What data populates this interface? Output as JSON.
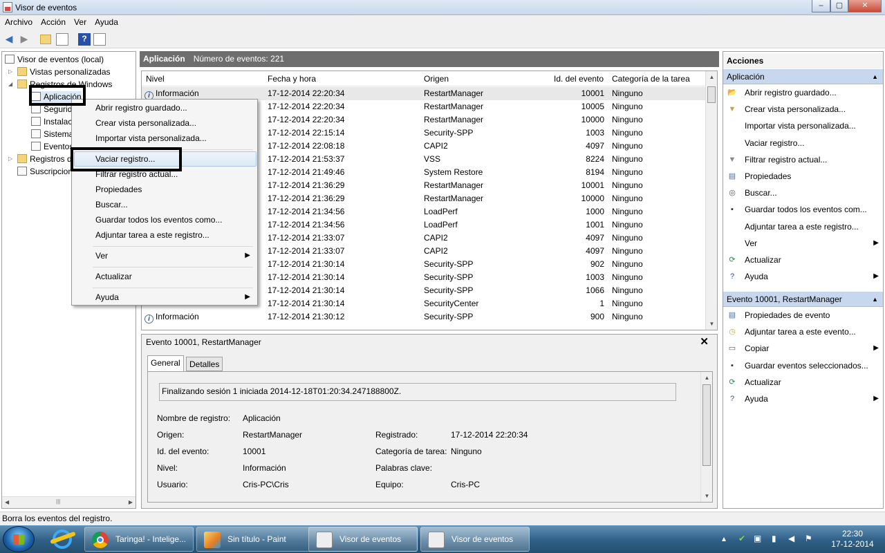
{
  "window": {
    "title": "Visor de eventos",
    "min": "–",
    "max": "▢",
    "close": "✕"
  },
  "menu": [
    "Archivo",
    "Acción",
    "Ver",
    "Ayuda"
  ],
  "tree": {
    "root": "Visor de eventos (local)",
    "custom": "Vistas personalizadas",
    "winlogs": "Registros de Windows",
    "app": "Aplicación",
    "security": "Segurid",
    "setup": "Instalac",
    "system": "Sistema",
    "forwarded": "Eventos",
    "appsvc": "Registros d",
    "subs": "Suscripcion"
  },
  "center": {
    "log_name": "Aplicación",
    "count_label": "Número de eventos: 221",
    "columns": [
      "Nivel",
      "Fecha y hora",
      "Origen",
      "Id. del evento",
      "Categoría de la tarea"
    ],
    "rows": [
      {
        "level": "Información",
        "date": "17-12-2014 22:20:34",
        "source": "RestartManager",
        "id": "10001",
        "cat": "Ninguno"
      },
      {
        "level": "",
        "date": "17-12-2014 22:20:34",
        "source": "RestartManager",
        "id": "10005",
        "cat": "Ninguno"
      },
      {
        "level": "",
        "date": "17-12-2014 22:20:34",
        "source": "RestartManager",
        "id": "10000",
        "cat": "Ninguno"
      },
      {
        "level": "",
        "date": "17-12-2014 22:15:14",
        "source": "Security-SPP",
        "id": "1003",
        "cat": "Ninguno"
      },
      {
        "level": "",
        "date": "17-12-2014 22:08:18",
        "source": "CAPI2",
        "id": "4097",
        "cat": "Ninguno"
      },
      {
        "level": "",
        "date": "17-12-2014 21:53:37",
        "source": "VSS",
        "id": "8224",
        "cat": "Ninguno"
      },
      {
        "level": "",
        "date": "17-12-2014 21:49:46",
        "source": "System Restore",
        "id": "8194",
        "cat": "Ninguno"
      },
      {
        "level": "",
        "date": "17-12-2014 21:36:29",
        "source": "RestartManager",
        "id": "10001",
        "cat": "Ninguno"
      },
      {
        "level": "",
        "date": "17-12-2014 21:36:29",
        "source": "RestartManager",
        "id": "10000",
        "cat": "Ninguno"
      },
      {
        "level": "",
        "date": "17-12-2014 21:34:56",
        "source": "LoadPerf",
        "id": "1000",
        "cat": "Ninguno"
      },
      {
        "level": "",
        "date": "17-12-2014 21:34:56",
        "source": "LoadPerf",
        "id": "1001",
        "cat": "Ninguno"
      },
      {
        "level": "",
        "date": "17-12-2014 21:33:07",
        "source": "CAPI2",
        "id": "4097",
        "cat": "Ninguno"
      },
      {
        "level": "",
        "date": "17-12-2014 21:33:07",
        "source": "CAPI2",
        "id": "4097",
        "cat": "Ninguno"
      },
      {
        "level": "",
        "date": "17-12-2014 21:30:14",
        "source": "Security-SPP",
        "id": "902",
        "cat": "Ninguno"
      },
      {
        "level": "",
        "date": "17-12-2014 21:30:14",
        "source": "Security-SPP",
        "id": "1003",
        "cat": "Ninguno"
      },
      {
        "level": "",
        "date": "17-12-2014 21:30:14",
        "source": "Security-SPP",
        "id": "1066",
        "cat": "Ninguno"
      },
      {
        "level": "",
        "date": "17-12-2014 21:30:14",
        "source": "SecurityCenter",
        "id": "1",
        "cat": "Ninguno"
      },
      {
        "level": "Información",
        "date": "17-12-2014 21:30:12",
        "source": "Security-SPP",
        "id": "900",
        "cat": "Ninguno"
      }
    ]
  },
  "detail": {
    "title": "Evento 10001, RestartManager",
    "close": "✕",
    "tab_general": "General",
    "tab_details": "Detalles",
    "message": "Finalizando sesión 1 iniciada 2014-12-18T01:20:34.247188800Z.",
    "log_name_label": "Nombre de registro:",
    "log_name": "Aplicación",
    "source_label": "Origen:",
    "source": "RestartManager",
    "logged_label": "Registrado:",
    "logged": "17-12-2014 22:20:34",
    "id_label": "Id. del evento:",
    "id": "10001",
    "taskcat_label": "Categoría de tarea:",
    "taskcat": "Ninguno",
    "level_label": "Nivel:",
    "level": "Información",
    "keywords_label": "Palabras clave:",
    "user_label": "Usuario:",
    "user": "Cris-PC\\Cris",
    "computer_label": "Equipo:",
    "computer": "Cris-PC"
  },
  "actions": {
    "header": "Acciones",
    "section1": "Aplicación",
    "items1": [
      "Abrir registro guardado...",
      "Crear vista personalizada...",
      "Importar vista personalizada...",
      "Vaciar registro...",
      "Filtrar registro actual...",
      "Propiedades",
      "Buscar...",
      "Guardar todos los eventos com...",
      "Adjuntar tarea a este registro...",
      "Ver",
      "Actualizar",
      "Ayuda"
    ],
    "section2": "Evento 10001, RestartManager",
    "items2": [
      "Propiedades de evento",
      "Adjuntar tarea a este evento...",
      "Copiar",
      "Guardar eventos seleccionados...",
      "Actualizar",
      "Ayuda"
    ]
  },
  "context_menu": [
    "Abrir registro guardado...",
    "Crear vista personalizada...",
    "Importar vista personalizada...",
    "Vaciar registro...",
    "Filtrar registro actual...",
    "Propiedades",
    "Buscar...",
    "Guardar todos los eventos como...",
    "Adjuntar tarea a este registro...",
    "Ver",
    "Actualizar",
    "Ayuda"
  ],
  "status": "Borra los eventos del registro.",
  "taskbar": {
    "items": [
      "Taringa! - Intelige...",
      "Sin título - Paint",
      "Visor de eventos",
      "Visor de eventos"
    ],
    "time": "22:30",
    "date": "17-12-2014"
  },
  "colors": {
    "accent": "#c7d8ee",
    "header": "#6e6e6e",
    "highlight": "#000000"
  }
}
